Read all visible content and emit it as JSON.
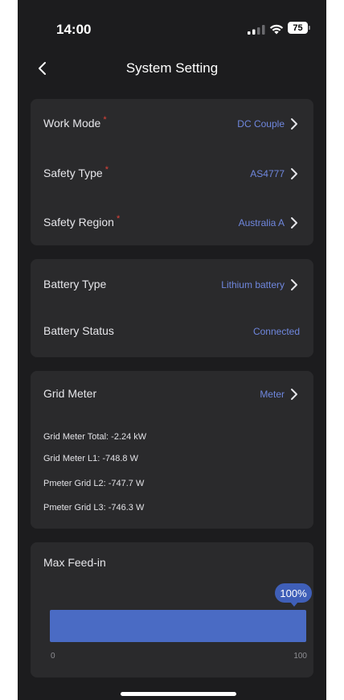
{
  "status_bar": {
    "time": "14:00",
    "battery": "75",
    "icons": [
      "cellular-signal-icon",
      "wifi-icon",
      "battery-icon"
    ]
  },
  "nav": {
    "title": "System Setting",
    "back_icon": "chevron-left-icon"
  },
  "settings": [
    {
      "label": "Work Mode",
      "required": "*",
      "value": "DC Couple"
    },
    {
      "label": "Safety Type",
      "required": "*",
      "value": "AS4777"
    },
    {
      "label": "Safety Region",
      "required": "*",
      "value": "Australia A"
    }
  ],
  "battery": {
    "type_label": "Battery Type",
    "type_value": "Lithium battery",
    "status_label": "Battery Status",
    "status_value": "Connected"
  },
  "grid": {
    "label": "Grid Meter",
    "value": "Meter",
    "lines": [
      "Grid Meter Total: -2.24 kW",
      "Grid Meter L1: -748.8 W",
      "Pmeter Grid L2: -747.7 W",
      "Pmeter Grid L3: -746.3 W"
    ]
  },
  "feed_in": {
    "label": "Max Feed-in",
    "percent_label": "100%",
    "percent": 100,
    "min_label": "0",
    "max_label": "100"
  },
  "colors": {
    "background": "#1c1c1e",
    "card": "#2a2a2c",
    "accent": "#6f87de",
    "required": "#e0433a",
    "slider_fill": "#4a6bc4"
  }
}
